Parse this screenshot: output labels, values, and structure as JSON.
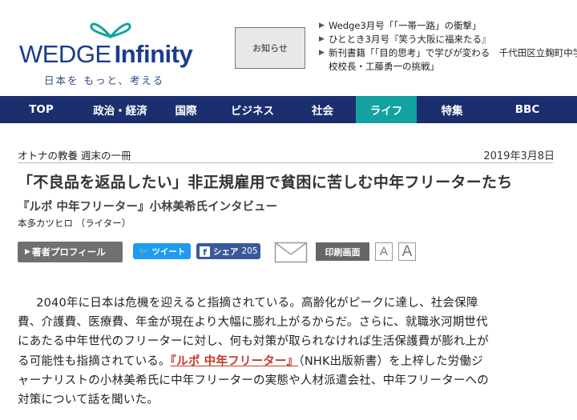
{
  "logo": {
    "wedge": "WEDGE",
    "infinity": "Infinity",
    "tagline": "日本を もっと、考える"
  },
  "header": {
    "notice_label": "お知らせ",
    "news": [
      {
        "text": "Wedge3月号「「一帯一路」の衝撃」"
      },
      {
        "text": "ひととき3月号『笑う大阪に福来たる』"
      },
      {
        "line1": "新刊書籍「「目的思考」で学びが変わる　千代田区立麹町中学",
        "line2": "校校長・工藤勇一の挑戦」"
      }
    ]
  },
  "nav": {
    "items": [
      {
        "label": "TOP",
        "active": false
      },
      {
        "label": "政治・経済",
        "active": false
      },
      {
        "label": "国際",
        "active": false
      },
      {
        "label": "ビジネス",
        "active": false
      },
      {
        "label": "社会",
        "active": false
      },
      {
        "label": "ライフ",
        "active": true
      },
      {
        "label": "特集",
        "active": false
      },
      {
        "label": "BBC",
        "active": false
      }
    ]
  },
  "article": {
    "breadcrumb": "オトナの教養 週末の一冊",
    "date": "2019年3月8日",
    "headline": "「不良品を返品したい」非正規雇用で貧困に苦しむ中年フリーターたち",
    "subtitle": "『ルポ 中年フリーター』小林美希氏インタビュー",
    "author": "本多カツヒロ （ライター）",
    "tools": {
      "profile_label": "著者プロフィール",
      "tweet_label": "ツイート",
      "share_label": "シェア",
      "share_count": "205",
      "print_label": "印刷画面",
      "font_small": "A",
      "font_large": "A"
    },
    "body_lines": [
      "2040年に日本は危機を迎えると指摘されている。高齢化がピークに達し、社会保障",
      "費、介護費、医療費、年金が現在より大幅に膨れ上がるからだ。さらに、就職氷河期世代",
      "にあたる中年世代のフリーターに対し、何も対策が取られなければ生活保護費が膨れ上が"
    ],
    "line4_before": "る可能性も指摘されている。",
    "line4_link": "『ルポ 中年フリーター』",
    "line4_after": "（NHK出版新書）を上梓した労働ジ",
    "body_lines_end": [
      "ャーナリストの小林美希氏に中年フリーターの実態や人材派遣会社、中年フリーターへの",
      "対策について話を聞いた。"
    ]
  },
  "colors": {
    "nav_bg": "#1b2f6e",
    "nav_active": "#13a29f",
    "link": "#c0392b",
    "twitter": "#1d9bf0",
    "facebook": "#3b5998"
  }
}
